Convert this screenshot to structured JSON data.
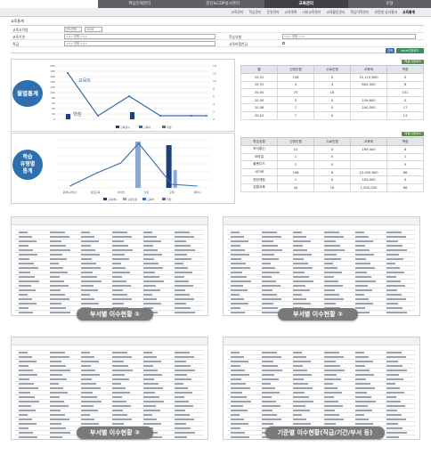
{
  "top_nav": {
    "tabs": [
      "핵심인재관리",
      "진단&CDP실시관리",
      "교육관리",
      "유형"
    ],
    "active_index": 2
  },
  "sub_nav": {
    "items": [
      "교육관리",
      "학습관리",
      "운영관리",
      "교육계획",
      "사외교육관리",
      "교육활동관리",
      "학습이력관리",
      "과정별 성과결과",
      "교육통계"
    ],
    "active_index": 8
  },
  "section_title": "교육통계",
  "filter": {
    "row1": {
      "label": "교육시작일",
      "select1": "반도전체",
      "select2": "2018"
    },
    "row2": {
      "label": "교육기관",
      "select": "=== 전체 ===",
      "label2": "학습유형",
      "select_right": "=== 전체 ==="
    },
    "row3": {
      "label": "직급",
      "select": "=== 전체 ===",
      "label2": "교육비협찬금"
    },
    "search_button": "검색",
    "excel_button": "excel다운로드"
  },
  "monthly": {
    "title": "월별통계",
    "excel_button": "엑셀 다운로드",
    "chart": {
      "annotations": [
        "교육비",
        "학점"
      ],
      "legend": [
        "교육생수",
        "교육비",
        "학점"
      ],
      "y_left_ticks": [
        "200",
        "180",
        "160",
        "140",
        "120",
        "100",
        "80",
        "60",
        "40",
        "20",
        "0"
      ],
      "y_right_ticks": [
        "14",
        "12",
        "10",
        "8",
        "6",
        "4",
        "2",
        "0"
      ]
    },
    "table": {
      "headers": [
        "월",
        "신청인원",
        "수료인원",
        "교육비",
        "학점"
      ],
      "rows": [
        [
          "20.01",
          "158",
          "0",
          "12,115,600",
          "0"
        ],
        [
          "20.03",
          "4",
          "4",
          "800,000",
          "8"
        ],
        [
          "20.04",
          "75",
          "16",
          "",
          "151"
        ],
        [
          "20.05",
          "3",
          "0",
          "159,600",
          "0"
        ],
        [
          "20.08",
          "7",
          "0",
          "200,000",
          "17"
        ],
        [
          "20.10",
          "7",
          "0",
          "",
          "14"
        ]
      ]
    }
  },
  "learning_type": {
    "title": "학습\n유형별\n통계",
    "excel_button": "엑셀 다운로드",
    "chart": {
      "legend": [
        "교육생수",
        "수료인원",
        "교육비",
        "학점"
      ],
      "categories": [
        "원격(e러닝)",
        "집합교육",
        "사이버",
        "신문",
        "교재",
        "세미나"
      ]
    },
    "table": {
      "headers": [
        "학습유형",
        "신청인원",
        "수료인원",
        "교육비",
        "학점"
      ],
      "rows": [
        [
          "독서통신",
          "10",
          "0",
          "169,400",
          "8"
        ],
        [
          "모바일",
          "1",
          "0",
          "",
          "1"
        ],
        [
          "블랜디드",
          "2",
          "0",
          "",
          "5"
        ],
        [
          "사이버",
          "196",
          "6",
          "12,005,800",
          "86"
        ],
        [
          "현장체험",
          "1",
          "0",
          "100,000",
          "0"
        ],
        [
          "집합교육",
          "44",
          "16",
          "1,000,000",
          "88"
        ]
      ]
    }
  },
  "thumbnails": [
    {
      "caption": "부서별 이수현황 ①"
    },
    {
      "caption": "부서별 이수현황 ②"
    },
    {
      "caption": "부서별 이수현황 ③"
    },
    {
      "caption": "기준별 이수현황(직급/기간/부서 등)"
    }
  ],
  "colors": {
    "nav_dark": "#5e6066",
    "chart_blue": "#2f6db5",
    "bar_light": "#8aa7d6",
    "bar_dark": "#1f3f7a",
    "label_blue": "#2e6fb0",
    "caption_gray": "#7a7a7a"
  }
}
